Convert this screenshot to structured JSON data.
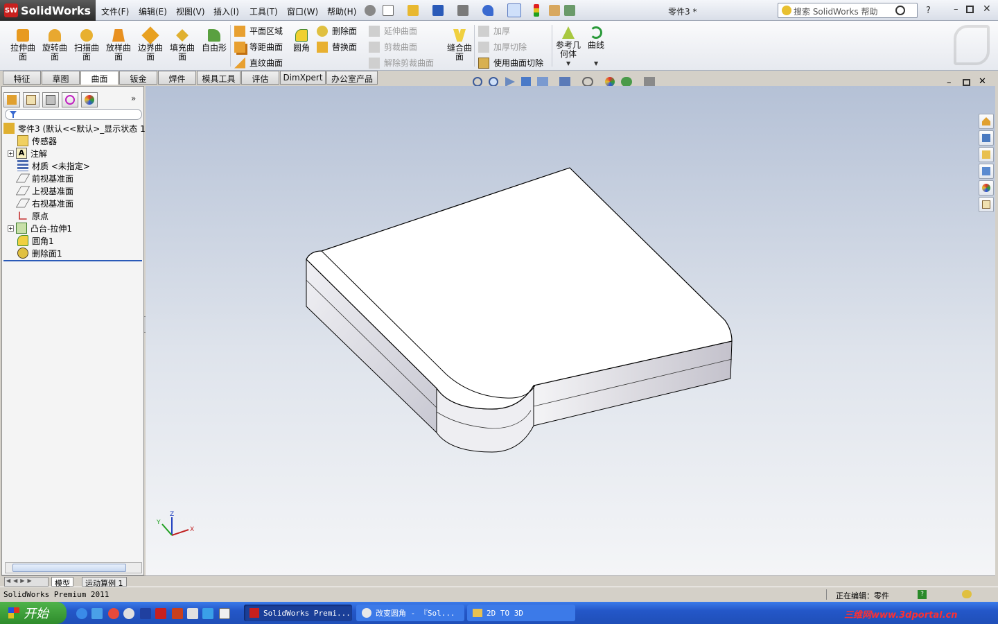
{
  "app": {
    "name": "SolidWorks",
    "logo_text": "SW",
    "doc_title": "零件3 *"
  },
  "menu": [
    "文件(F)",
    "编辑(E)",
    "视图(V)",
    "插入(I)",
    "工具(T)",
    "窗口(W)",
    "帮助(H)"
  ],
  "search": {
    "placeholder": "搜索 SolidWorks 帮助"
  },
  "ribbon": {
    "big": [
      "拉伸曲面",
      "旋转曲面",
      "扫描曲面",
      "放样曲面",
      "边界曲面",
      "填充曲面",
      "自由形"
    ],
    "group1": [
      "平面区域",
      "等距曲面",
      "直纹曲面"
    ],
    "fillet": "圆角",
    "group2": [
      "删除面",
      "替换面"
    ],
    "group3_disabled": [
      "延伸曲面",
      "剪裁曲面",
      "解除剪裁曲面"
    ],
    "knit": "缝合曲面",
    "group4": [
      "加厚",
      "加厚切除",
      "使用曲面切除"
    ],
    "refgeo": "参考几何体",
    "curves": "曲线"
  },
  "tabs": [
    "特征",
    "草图",
    "曲面",
    "钣金",
    "焊件",
    "模具工具",
    "评估",
    "DimXpert",
    "办公室产品"
  ],
  "active_tab": "曲面",
  "tree": [
    {
      "label": "零件3  (默认<<默认>_显示状态 1",
      "icon": "part-icon"
    },
    {
      "label": "传感器",
      "icon": "sensor-icon"
    },
    {
      "label": "注解",
      "icon": "annotation-icon"
    },
    {
      "label": "材质 <未指定>",
      "icon": "material-icon"
    },
    {
      "label": "前视基准面",
      "icon": "plane-icon"
    },
    {
      "label": "上视基准面",
      "icon": "plane-icon"
    },
    {
      "label": "右视基准面",
      "icon": "plane-icon"
    },
    {
      "label": "原点",
      "icon": "origin-icon"
    },
    {
      "label": "凸台-拉伸1",
      "icon": "extrude-icon"
    },
    {
      "label": "圆角1",
      "icon": "fillet-icon"
    },
    {
      "label": "删除面1",
      "icon": "delete-face-icon"
    }
  ],
  "bottom_tabs": [
    "模型",
    "运动算例 1"
  ],
  "status": {
    "left": "SolidWorks Premium 2011",
    "editing": "正在编辑：零件"
  },
  "taskbar": {
    "start": "开始",
    "tasks": [
      "SolidWorks Premi...",
      "改变圆角 - 『Sol...",
      "2D TO 3D"
    ],
    "watermark": "三维网www.3dportal.cn"
  },
  "triad": {
    "x": "X",
    "y": "Y",
    "z": "Z"
  },
  "colors": {
    "accent": "#c8201e",
    "viewport_top": "#b5c1d6",
    "taskbar": "#2457c8"
  }
}
